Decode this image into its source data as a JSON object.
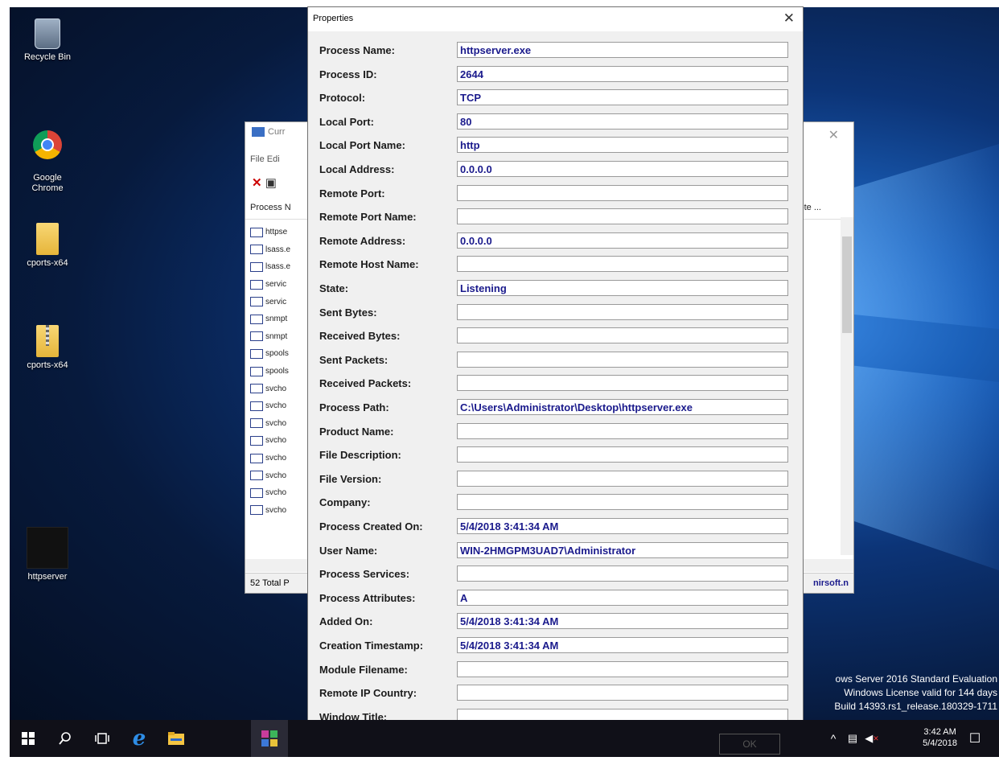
{
  "desktop": {
    "icons": [
      {
        "label": "Recycle Bin"
      },
      {
        "label": "Google\nChrome"
      },
      {
        "label": "cports-x64"
      },
      {
        "label": "cports-x64"
      },
      {
        "label": "httpserver"
      }
    ],
    "watermark": [
      "ows Server 2016 Standard Evaluation",
      "Windows License valid for 144 days",
      "Build 14393.rs1_release.180329-1711"
    ]
  },
  "background_window": {
    "title": "Curr",
    "menu": "File  Edi",
    "header_left": "Process N",
    "header_right": "ote ...",
    "rows": [
      "httpse",
      "lsass.e",
      "lsass.e",
      "servic",
      "servic",
      "snmpt",
      "snmpt",
      "spools",
      "spools",
      "svcho",
      "svcho",
      "svcho",
      "svcho",
      "svcho",
      "svcho",
      "svcho",
      "svcho"
    ],
    "status_left": "52 Total P",
    "status_right": "nirsoft.n"
  },
  "dialog": {
    "title": "Properties",
    "close_glyph": "✕",
    "fields": [
      {
        "label": "Process Name:",
        "value": "httpserver.exe"
      },
      {
        "label": "Process ID:",
        "value": "2644"
      },
      {
        "label": "Protocol:",
        "value": "TCP"
      },
      {
        "label": "Local Port:",
        "value": "80"
      },
      {
        "label": "Local Port Name:",
        "value": "http"
      },
      {
        "label": "Local Address:",
        "value": "0.0.0.0"
      },
      {
        "label": "Remote Port:",
        "value": ""
      },
      {
        "label": "Remote Port Name:",
        "value": ""
      },
      {
        "label": "Remote Address:",
        "value": "0.0.0.0"
      },
      {
        "label": "Remote Host Name:",
        "value": ""
      },
      {
        "label": "State:",
        "value": "Listening"
      },
      {
        "label": "Sent Bytes:",
        "value": ""
      },
      {
        "label": "Received Bytes:",
        "value": ""
      },
      {
        "label": "Sent Packets:",
        "value": ""
      },
      {
        "label": "Received Packets:",
        "value": ""
      },
      {
        "label": "Process Path:",
        "value": "C:\\Users\\Administrator\\Desktop\\httpserver.exe"
      },
      {
        "label": "Product Name:",
        "value": ""
      },
      {
        "label": "File Description:",
        "value": ""
      },
      {
        "label": "File Version:",
        "value": ""
      },
      {
        "label": "Company:",
        "value": ""
      },
      {
        "label": "Process Created On:",
        "value": "5/4/2018 3:41:34 AM"
      },
      {
        "label": "User Name:",
        "value": "WIN-2HMGPM3UAD7\\Administrator"
      },
      {
        "label": "Process Services:",
        "value": ""
      },
      {
        "label": "Process Attributes:",
        "value": "A"
      },
      {
        "label": "Added On:",
        "value": "5/4/2018 3:41:34 AM"
      },
      {
        "label": "Creation Timestamp:",
        "value": "5/4/2018 3:41:34 AM"
      },
      {
        "label": "Module Filename:",
        "value": ""
      },
      {
        "label": "Remote IP Country:",
        "value": ""
      },
      {
        "label": "Window Title:",
        "value": ""
      }
    ],
    "ok_label": "OK"
  },
  "taskbar": {
    "time": "3:42 AM",
    "date": "5/4/2018"
  }
}
